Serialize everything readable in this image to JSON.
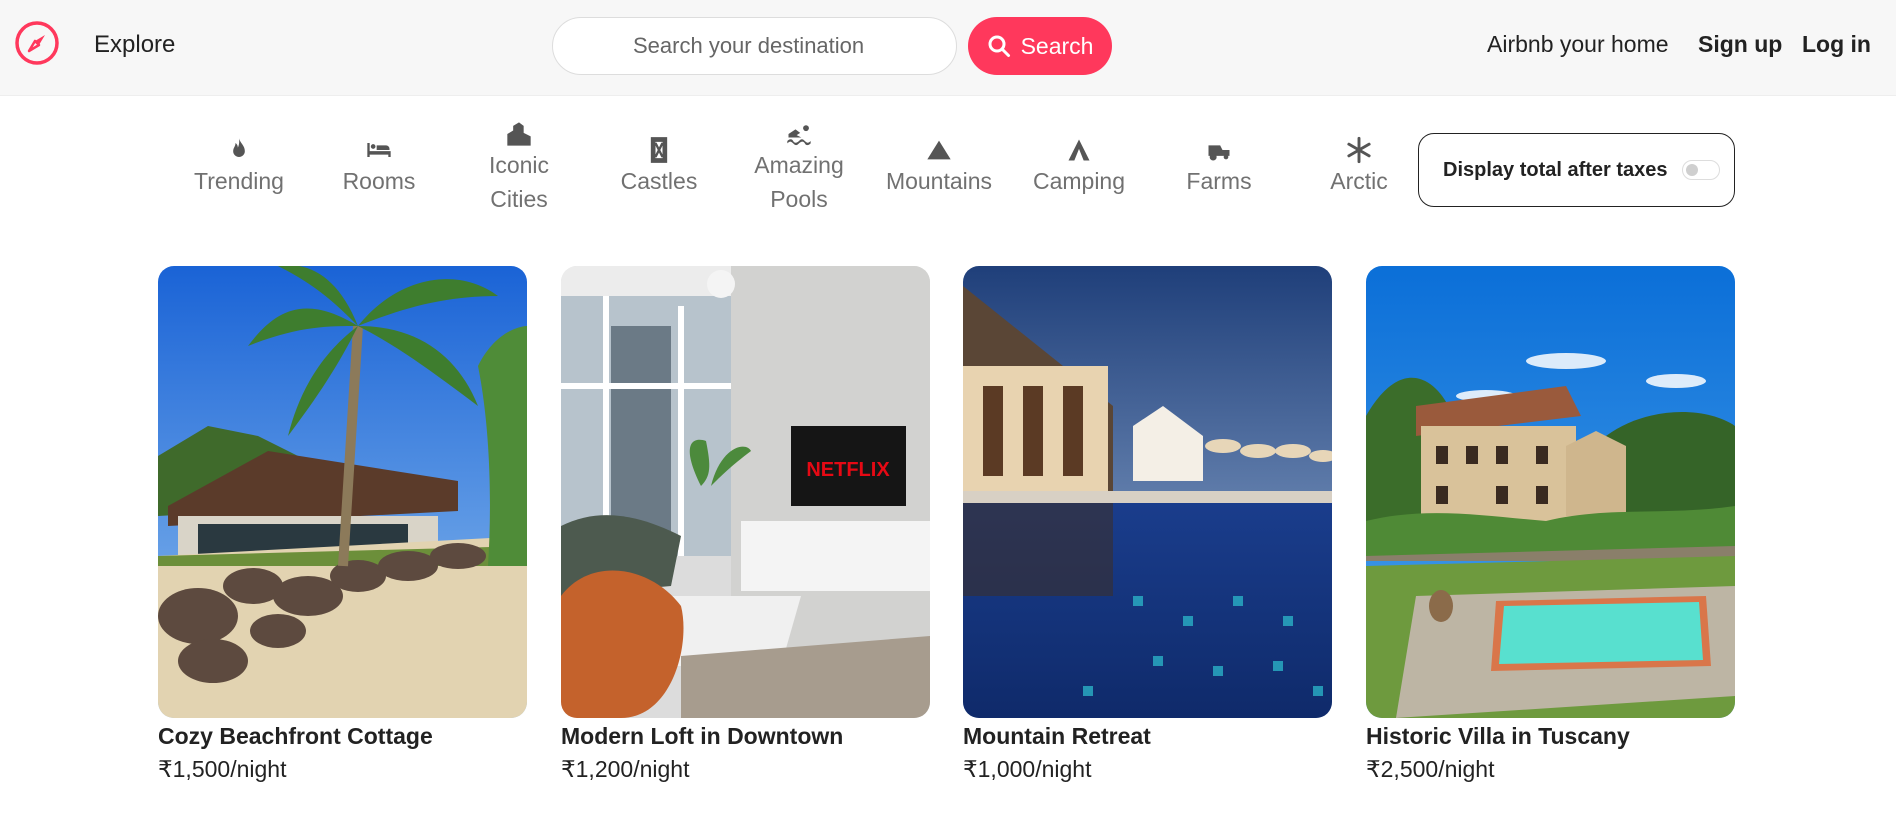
{
  "nav": {
    "explore_label": "Explore",
    "search_placeholder": "Search your destination",
    "search_button": "Search",
    "host_link": "Airbnb your home",
    "signup": "Sign up",
    "login": "Log in",
    "brand_color": "#ff385c"
  },
  "categories": [
    {
      "label": "Trending",
      "icon": "fire-icon"
    },
    {
      "label": "Rooms",
      "icon": "bed-icon"
    },
    {
      "label": "Iconic Cities",
      "icon": "city-icon"
    },
    {
      "label": "Castles",
      "icon": "castle-icon"
    },
    {
      "label": "Amazing Pools",
      "icon": "swimmer-icon"
    },
    {
      "label": "Mountains",
      "icon": "mountain-icon"
    },
    {
      "label": "Camping",
      "icon": "tent-icon"
    },
    {
      "label": "Farms",
      "icon": "tractor-icon"
    },
    {
      "label": "Arctic",
      "icon": "snowflake-icon"
    }
  ],
  "tax_toggle": {
    "label": "Display total after taxes",
    "enabled": false
  },
  "listings": [
    {
      "title": "Cozy Beachfront Cottage",
      "price": "₹1,500/night"
    },
    {
      "title": "Modern Loft in Downtown",
      "price": "₹1,200/night"
    },
    {
      "title": "Mountain Retreat",
      "price": "₹1,000/night"
    },
    {
      "title": "Historic Villa in Tuscany",
      "price": "₹2,500/night"
    }
  ]
}
